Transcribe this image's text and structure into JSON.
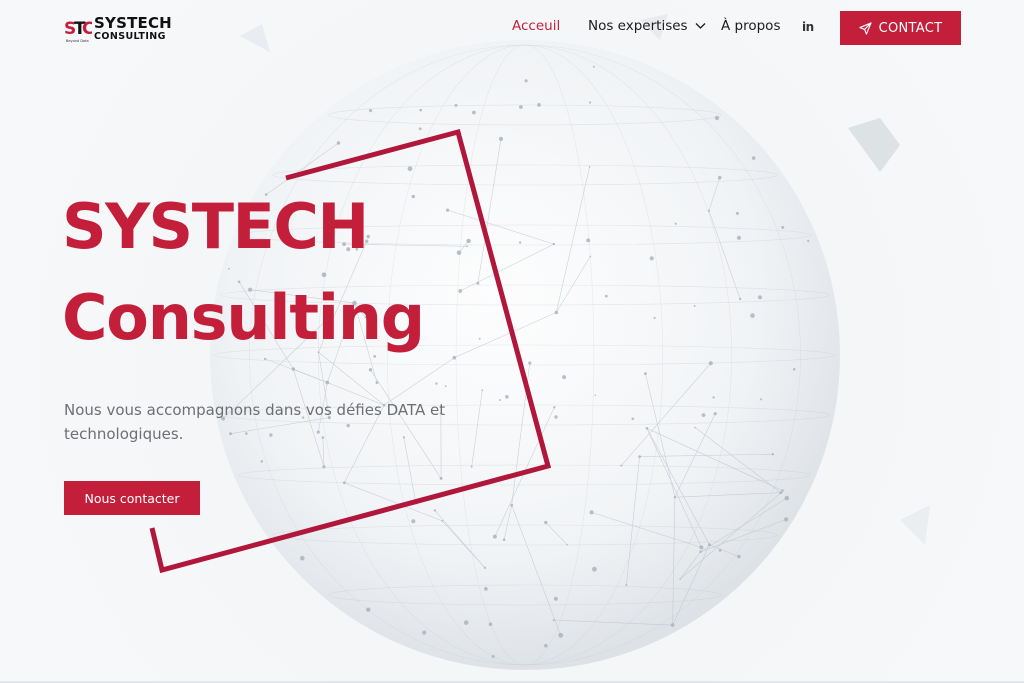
{
  "brand": {
    "logo_mark": "STC",
    "name_line1": "SYSTECH",
    "name_line2": "CONSULTING",
    "tagline": "Beyond Data",
    "accent_color": "#c31f3a"
  },
  "nav": {
    "items": [
      {
        "label": "Acceuil",
        "active": true
      },
      {
        "label": "Nos expertises",
        "active": false,
        "has_dropdown": true
      },
      {
        "label": "À propos",
        "active": false
      }
    ],
    "social_icon": "linkedin-icon",
    "social_label": "in",
    "contact_label": "CONTACT",
    "contact_icon": "paper-plane-icon"
  },
  "hero": {
    "title_line1": "SYSTECH",
    "title_line2": "Consulting",
    "subtitle": "Nous vous accompagnons dans vos défies DATA et technologiques.",
    "cta_label": "Nous contacter"
  }
}
